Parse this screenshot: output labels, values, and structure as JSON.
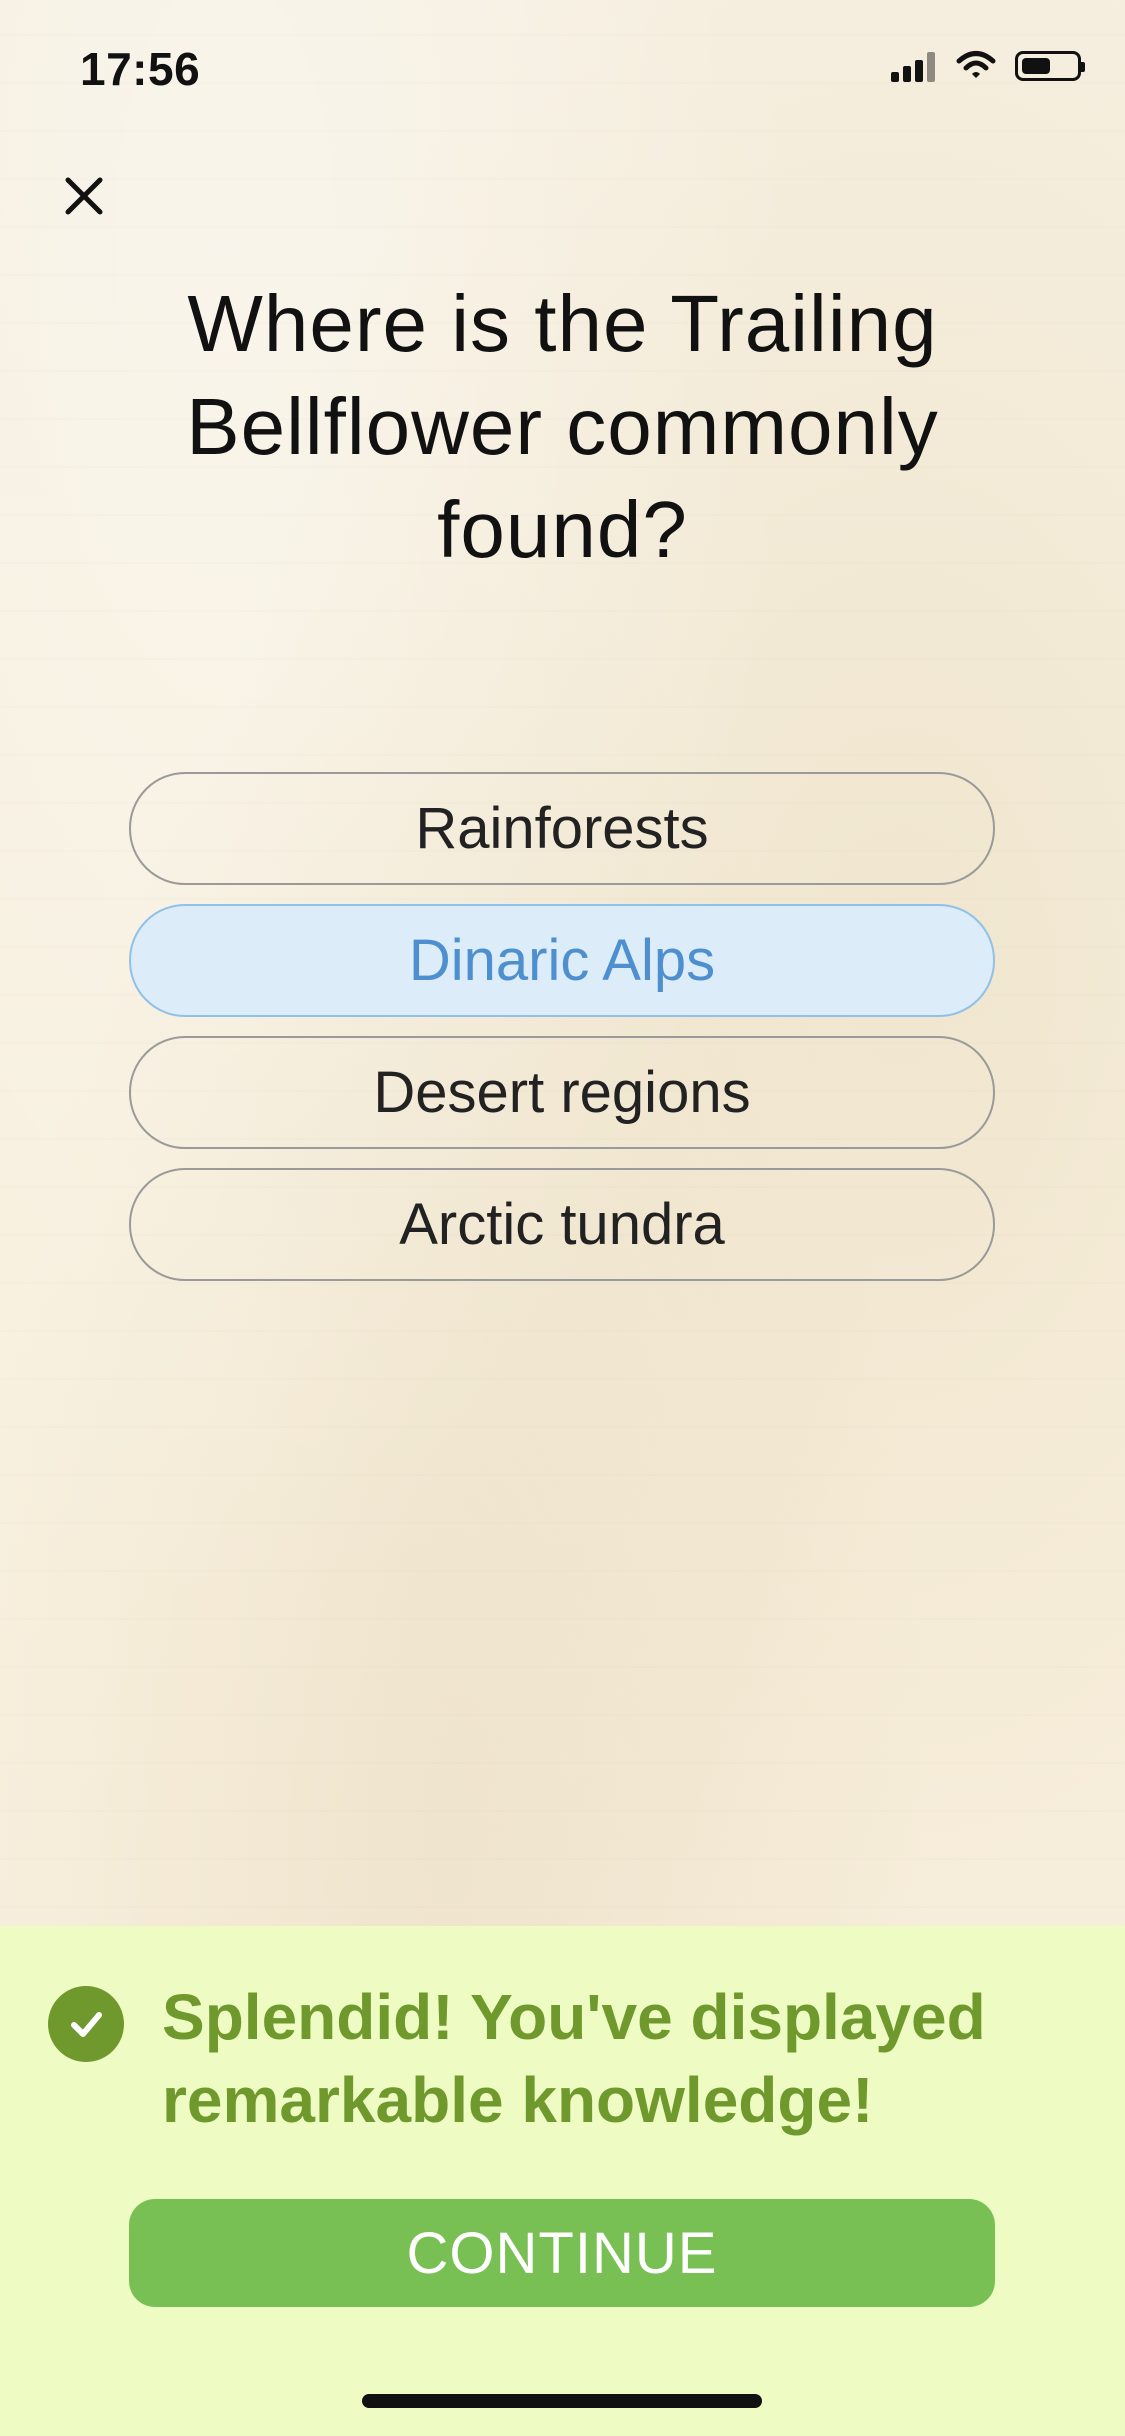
{
  "status_bar": {
    "time": "17:56",
    "signal_icon": "signal-icon",
    "wifi_icon": "wifi-icon",
    "battery_icon": "battery-icon"
  },
  "header": {
    "close_icon": "close-icon"
  },
  "quiz": {
    "question": "Where is the Trailing Bellflower commonly found?",
    "answers": [
      {
        "label": "Rainforests",
        "selected": false
      },
      {
        "label": "Dinaric Alps",
        "selected": true
      },
      {
        "label": "Desert regions",
        "selected": false
      },
      {
        "label": "Arctic tundra",
        "selected": false
      }
    ]
  },
  "feedback": {
    "status_icon": "check-circle-icon",
    "message": "Splendid! You've displayed remarkable knowledge!",
    "continue_label": "CONTINUE"
  },
  "colors": {
    "background": "#f6efe0",
    "selected_answer_bg": "#dcecf9",
    "selected_answer_border": "#8fc1ea",
    "selected_answer_text": "#4d8fcf",
    "feedback_bg": "#eefcc4",
    "feedback_text": "#6f982d",
    "continue_button": "#79c054"
  }
}
